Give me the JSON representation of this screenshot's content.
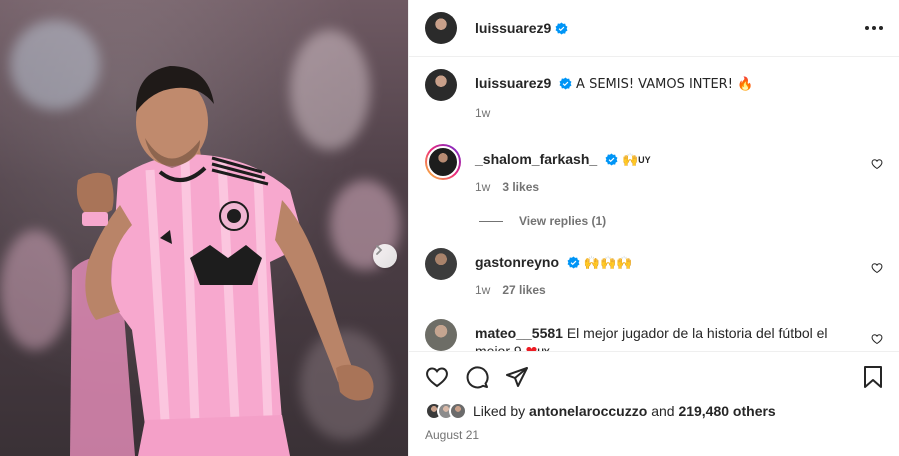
{
  "post": {
    "author": "luissuarez9",
    "caption": "A SEMIS! VAMOS INTER! 🔥",
    "caption_time": "1w",
    "date": "August 21"
  },
  "comments": [
    {
      "username": "_shalom_farkash_",
      "verified": true,
      "emoji": "🙌",
      "flag": "UY",
      "time": "1w",
      "likes": "3 likes"
    },
    {
      "username": "gastonreyno",
      "verified": true,
      "emoji": "🙌🙌🙌",
      "time": "1w",
      "likes": "27 likes"
    },
    {
      "username": "mateo__5581",
      "verified": false,
      "text": "El mejor jugador de la historia del fútbol el mejor 9",
      "emoji": "❤",
      "flag": "UY"
    }
  ],
  "view_replies": "View replies (1)",
  "likes": {
    "prefix": "Liked by",
    "user": "antonelaroccuzzo",
    "middle": "and",
    "count": "219,480 others"
  },
  "colors": {
    "verified": "#0095f6",
    "jersey_pink": "#f6a9cf",
    "text": "#262626",
    "muted": "#737373"
  },
  "icons": [
    "verified-badge-icon",
    "more-options-icon",
    "heart-icon",
    "comment-icon",
    "share-icon",
    "bookmark-icon",
    "chevron-right-icon"
  ]
}
